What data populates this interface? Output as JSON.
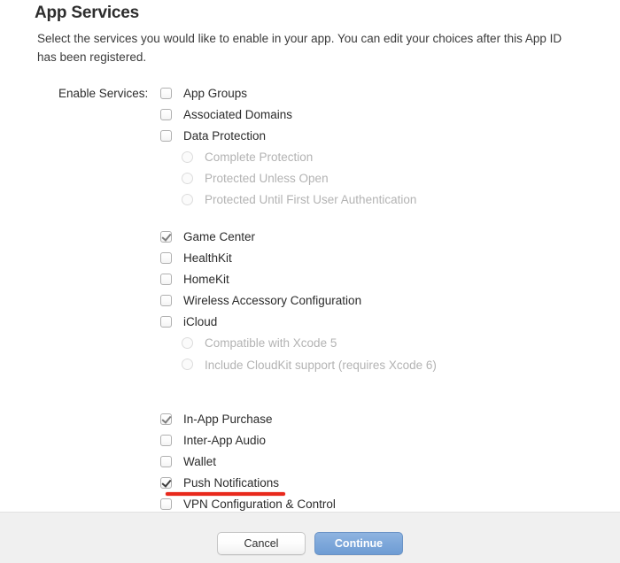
{
  "page": {
    "title": "App Services",
    "description": "Select the services you would like to enable in your app. You can edit your choices after this App ID has been registered."
  },
  "form": {
    "enable_services_label": "Enable Services:",
    "services": [
      {
        "label": "App Groups",
        "type": "checkbox",
        "checked": false,
        "disabled": false,
        "indent": 0
      },
      {
        "label": "Associated Domains",
        "type": "checkbox",
        "checked": false,
        "disabled": false,
        "indent": 0
      },
      {
        "label": "Data Protection",
        "type": "checkbox",
        "checked": false,
        "disabled": false,
        "indent": 0
      },
      {
        "label": "Complete Protection",
        "type": "radio",
        "checked": false,
        "disabled": true,
        "indent": 1
      },
      {
        "label": "Protected Unless Open",
        "type": "radio",
        "checked": false,
        "disabled": true,
        "indent": 1
      },
      {
        "label": "Protected Until First User Authentication",
        "type": "radio",
        "checked": false,
        "disabled": true,
        "indent": 1
      },
      {
        "label": "Game Center",
        "type": "checkbox",
        "checked": true,
        "disabled": true,
        "indent": 0
      },
      {
        "label": "HealthKit",
        "type": "checkbox",
        "checked": false,
        "disabled": false,
        "indent": 0
      },
      {
        "label": "HomeKit",
        "type": "checkbox",
        "checked": false,
        "disabled": false,
        "indent": 0
      },
      {
        "label": "Wireless Accessory Configuration",
        "type": "checkbox",
        "checked": false,
        "disabled": false,
        "indent": 0
      },
      {
        "label": "iCloud",
        "type": "checkbox",
        "checked": false,
        "disabled": false,
        "indent": 0
      },
      {
        "label": "Compatible with Xcode 5",
        "type": "radio",
        "checked": false,
        "disabled": true,
        "indent": 1
      },
      {
        "label": "Include CloudKit support (requires Xcode 6)",
        "type": "radio",
        "checked": false,
        "disabled": true,
        "indent": 1
      },
      {
        "label": "In-App Purchase",
        "type": "checkbox",
        "checked": true,
        "disabled": true,
        "indent": 0
      },
      {
        "label": "Inter-App Audio",
        "type": "checkbox",
        "checked": false,
        "disabled": false,
        "indent": 0
      },
      {
        "label": "Wallet",
        "type": "checkbox",
        "checked": false,
        "disabled": false,
        "indent": 0
      },
      {
        "label": "Push Notifications",
        "type": "checkbox",
        "checked": true,
        "disabled": false,
        "indent": 0
      },
      {
        "label": "VPN Configuration & Control",
        "type": "checkbox",
        "checked": false,
        "disabled": false,
        "indent": 0
      }
    ]
  },
  "annotation": {
    "target_label": "Push Notifications",
    "color": "#e8291c",
    "style": "underline"
  },
  "footer": {
    "cancel_label": "Cancel",
    "continue_label": "Continue"
  }
}
